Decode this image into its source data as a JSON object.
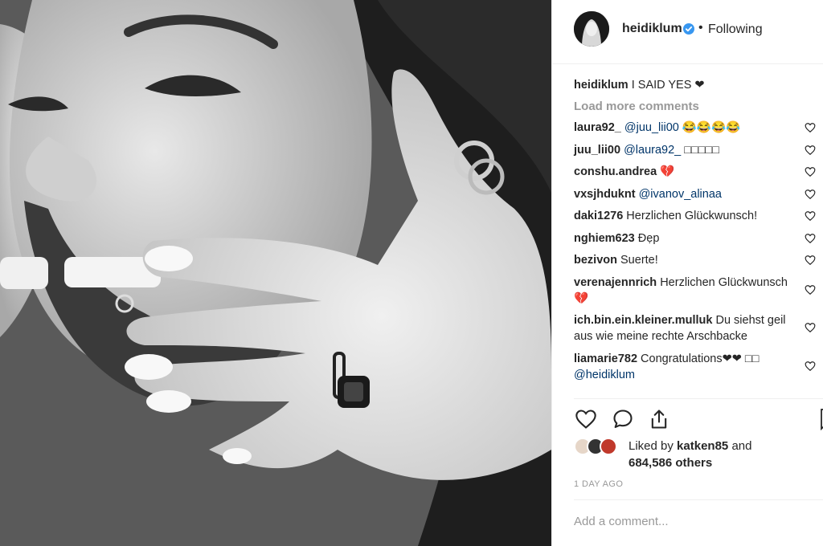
{
  "post": {
    "username": "heidiklum",
    "following_label": "Following",
    "separator": "•",
    "caption_user": "heidiklum",
    "caption_text": "I SAID YES ❤"
  },
  "load_more": "Load more comments",
  "comments": [
    {
      "user": "laura92_",
      "mention": "@juu_lii00",
      "text": " 😂😂😂😂"
    },
    {
      "user": "juu_lii00",
      "mention": "@laura92_",
      "text": " □□□□□"
    },
    {
      "user": "conshu.andrea",
      "mention": "",
      "text": " 💔"
    },
    {
      "user": "vxsjhduknt",
      "mention": "@ivanov_alinaa",
      "text": ""
    },
    {
      "user": "daki1276",
      "mention": "",
      "text": " Herzlichen Glückwunsch!"
    },
    {
      "user": "nghiem623",
      "mention": "",
      "text": " Đẹp"
    },
    {
      "user": "bezivon",
      "mention": "",
      "text": " Suerte!"
    },
    {
      "user": "verenajennrich",
      "mention": "",
      "text": " Herzlichen Glückwunsch 💔"
    },
    {
      "user": "ich.bin.ein.kleiner.mulluk",
      "mention": "",
      "text": " Du siehst geil aus wie meine rechte Arschbacke"
    },
    {
      "user": "liamarie782",
      "mention": "",
      "text": " Congratulations❤❤ □□ ",
      "mention_after": "@heidiklum"
    }
  ],
  "likes": {
    "prefix": "Liked by",
    "user": "katken85",
    "suffix": "and",
    "others": "684,586 others"
  },
  "timestamp": "1 DAY AGO",
  "add_comment_placeholder": "Add a comment...",
  "icons": {
    "like": "heart-outline-icon",
    "comment": "speech-bubble-icon",
    "share": "share-icon",
    "save": "bookmark-icon",
    "verified": "verified-badge-icon"
  },
  "colors": {
    "verified_blue": "#3897f0",
    "mention_blue": "#003569",
    "muted": "#999999"
  }
}
